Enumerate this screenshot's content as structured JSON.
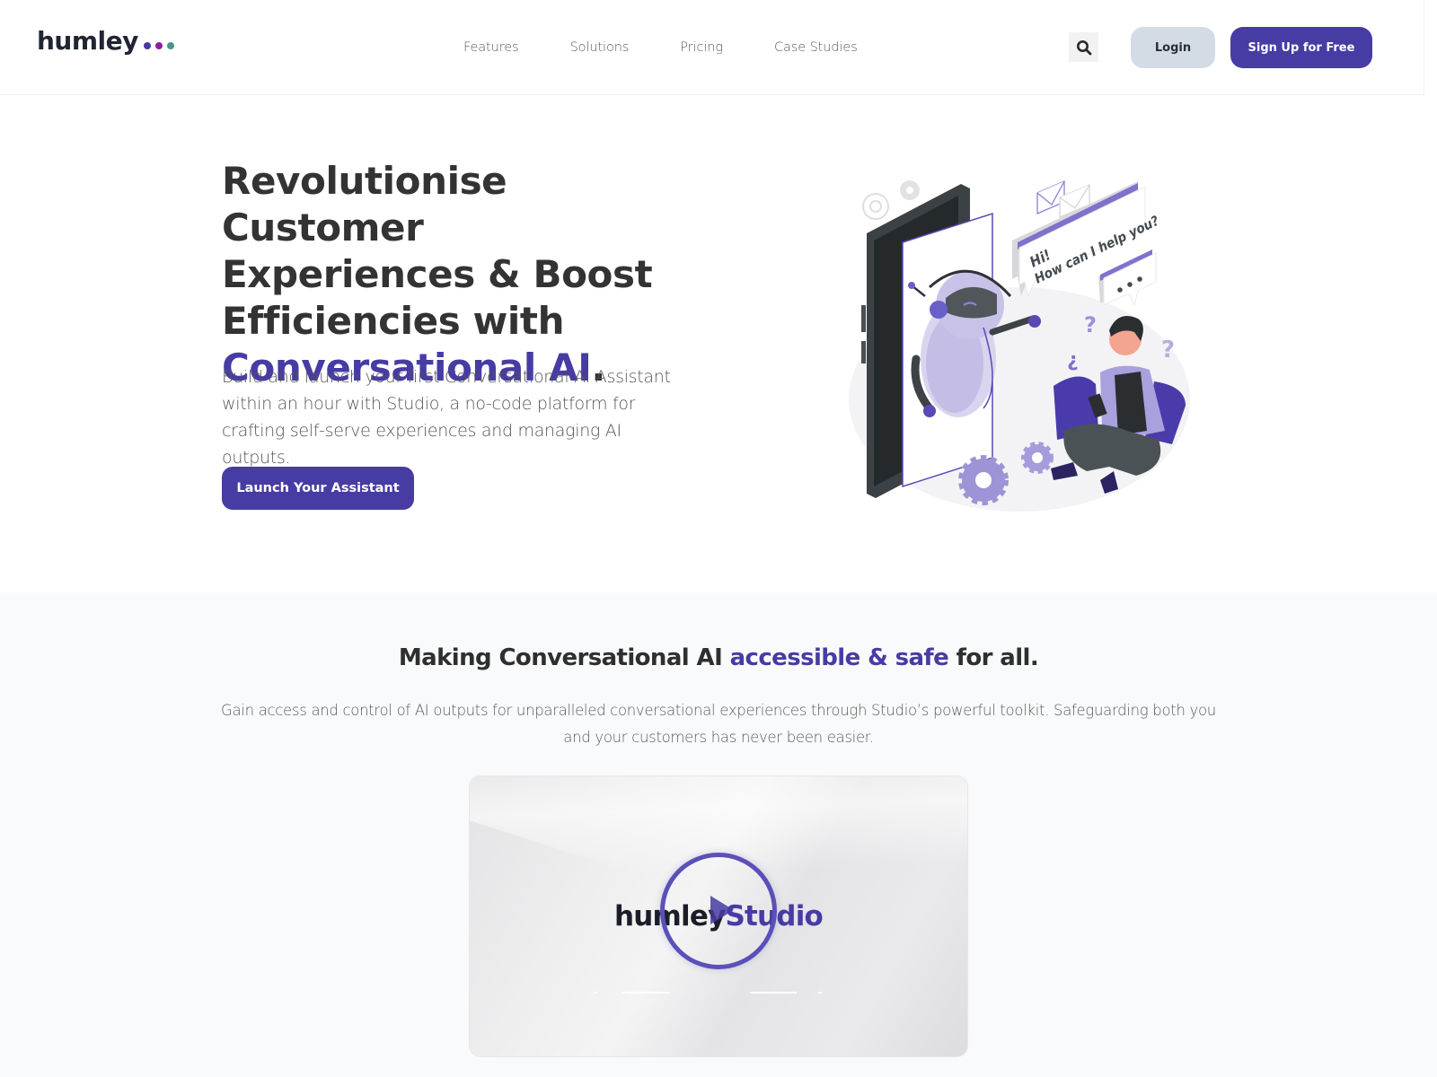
{
  "header": {
    "logo_text": "humley",
    "logo_dot_colors": [
      "#473ca3",
      "#8c1fa0",
      "#4a9486"
    ],
    "nav": [
      {
        "label": "Features"
      },
      {
        "label": "Solutions"
      },
      {
        "label": "Pricing"
      },
      {
        "label": "Case Studies"
      }
    ],
    "search_icon": "search-icon",
    "login_label": "Login",
    "signup_label": "Sign Up for Free"
  },
  "hero": {
    "title_line1": "Revolutionise Customer",
    "title_line2": "Experiences & Boost",
    "title_line3": "Efficiencies with",
    "title_accent": "Conversational AI",
    "title_end": ".",
    "subtitle": "Build and launch your first Conversational AI Assistant within an hour with Studio, a no-code platform for crafting self-serve experiences and managing AI outputs.",
    "cta_label": "Launch Your Assistant",
    "illustration": {
      "speech_line1": "Hi!",
      "speech_line2": "How can I help you?",
      "typing_bubble": "..."
    }
  },
  "section2": {
    "title_pre": "Making Conversational AI ",
    "title_accent": "accessible & safe",
    "title_post": " for all.",
    "description": "Gain access and control of AI outputs for unparalleled conversational experiences through Studio’s powerful toolkit. Safeguarding both you and your customers has never been easier.",
    "video": {
      "logo_left": "humley",
      "logo_right": "Studio",
      "play_icon": "play-icon"
    }
  },
  "colors": {
    "brand": "#473ca3",
    "text_dark": "#333333",
    "login_bg": "#d3dbe5",
    "section_bg": "#f9fafb"
  }
}
